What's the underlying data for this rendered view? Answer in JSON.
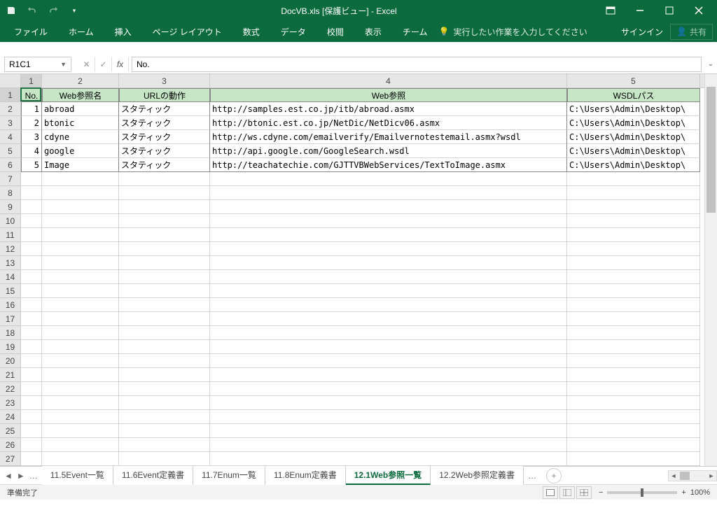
{
  "title": "DocVB.xls [保護ビュー] - Excel",
  "qat": {
    "save": "save-icon",
    "undo": "undo-icon",
    "redo": "redo-icon"
  },
  "ribbon": {
    "tabs": [
      "ファイル",
      "ホーム",
      "挿入",
      "ページ レイアウト",
      "数式",
      "データ",
      "校閲",
      "表示",
      "チーム"
    ],
    "tell_me": "実行したい作業を入力してください",
    "signin": "サインイン",
    "share": "共有"
  },
  "namebox": "R1C1",
  "formula": "No.",
  "columns": [
    "1",
    "2",
    "3",
    "4",
    "5"
  ],
  "header_row": [
    "No.",
    "Web参照名",
    "URLの動作",
    "Web参照",
    "WSDLパス"
  ],
  "rows": [
    {
      "no": "1",
      "name": "abroad",
      "url_mode": "スタティック",
      "web": "http://samples.est.co.jp/itb/abroad.asmx",
      "wsdl": "C:\\Users\\Admin\\Desktop\\"
    },
    {
      "no": "2",
      "name": "btonic",
      "url_mode": "スタティック",
      "web": "http://btonic.est.co.jp/NetDic/NetDicv06.asmx",
      "wsdl": "C:\\Users\\Admin\\Desktop\\"
    },
    {
      "no": "3",
      "name": "cdyne",
      "url_mode": "スタティック",
      "web": "http://ws.cdyne.com/emailverify/Emailvernotestemail.asmx?wsdl",
      "wsdl": "C:\\Users\\Admin\\Desktop\\"
    },
    {
      "no": "4",
      "name": "google",
      "url_mode": "スタティック",
      "web": "http://api.google.com/GoogleSearch.wsdl",
      "wsdl": "C:\\Users\\Admin\\Desktop\\"
    },
    {
      "no": "5",
      "name": "Image",
      "url_mode": "スタティック",
      "web": "http://teachatechie.com/GJTTVBWebServices/TextToImage.asmx",
      "wsdl": "C:\\Users\\Admin\\Desktop\\"
    }
  ],
  "row_count": 27,
  "sheet_tabs": [
    "11.5Event一覧",
    "11.6Event定義書",
    "11.7Enum一覧",
    "11.8Enum定義書",
    "12.1Web参照一覧",
    "12.2Web参照定義書"
  ],
  "active_tab": 4,
  "status": "準備完了",
  "zoom": "100%"
}
